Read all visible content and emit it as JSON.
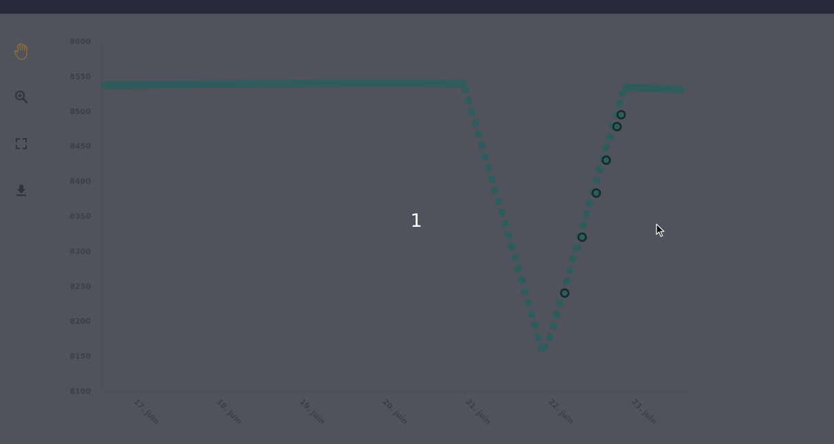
{
  "colors": {
    "background": "#50535b",
    "topbar": "#262a3c",
    "series": "#2f5b5c",
    "highlight_stroke": "#16292b",
    "axis_text": "#3b3f49",
    "tool_active": "#8a6a3c",
    "tool_icon": "#2f3340"
  },
  "toolbar": {
    "items": [
      {
        "name": "pan-hand-icon",
        "active": true
      },
      {
        "name": "zoom-in-icon",
        "active": false
      },
      {
        "name": "fullscreen-icon",
        "active": false
      },
      {
        "name": "download-icon",
        "active": false
      }
    ]
  },
  "overlay": {
    "number": "1"
  },
  "chart_data": {
    "type": "scatter",
    "title": "",
    "xlabel": "",
    "ylabel": "",
    "ylim": [
      8100,
      8600
    ],
    "yticks": [
      8100,
      8150,
      8200,
      8250,
      8300,
      8350,
      8400,
      8450,
      8500,
      8550,
      8600
    ],
    "xlim": [
      16.62,
      23.72
    ],
    "xticks": [
      {
        "value": 17,
        "label": "17. juin"
      },
      {
        "value": 18,
        "label": "18. juin"
      },
      {
        "value": 19,
        "label": "19. juin"
      },
      {
        "value": 20,
        "label": "20. juin"
      },
      {
        "value": 21,
        "label": "21. juin"
      },
      {
        "value": 22,
        "label": "22. juin"
      },
      {
        "value": 23,
        "label": "23. juin"
      }
    ],
    "grid": false,
    "series": [
      {
        "plateau_segments": [
          {
            "x": [
              16.65,
              17.5,
              18.5,
              19.5,
              20.5,
              20.98
            ],
            "y": [
              8537,
              8538,
              8539,
              8540,
              8540,
              8539
            ]
          },
          {
            "x": [
              22.99,
              23.6
            ],
            "y": [
              8534,
              8531
            ]
          }
        ],
        "points": [
          {
            "x": 21.0,
            "y": 8531
          },
          {
            "x": 21.04,
            "y": 8515
          },
          {
            "x": 21.08,
            "y": 8499
          },
          {
            "x": 21.12,
            "y": 8483
          },
          {
            "x": 21.16,
            "y": 8467
          },
          {
            "x": 21.2,
            "y": 8451
          },
          {
            "x": 21.24,
            "y": 8435
          },
          {
            "x": 21.28,
            "y": 8419
          },
          {
            "x": 21.32,
            "y": 8403
          },
          {
            "x": 21.36,
            "y": 8387
          },
          {
            "x": 21.4,
            "y": 8371
          },
          {
            "x": 21.44,
            "y": 8355
          },
          {
            "x": 21.48,
            "y": 8339
          },
          {
            "x": 21.52,
            "y": 8323
          },
          {
            "x": 21.56,
            "y": 8307
          },
          {
            "x": 21.6,
            "y": 8291
          },
          {
            "x": 21.64,
            "y": 8275
          },
          {
            "x": 21.68,
            "y": 8259
          },
          {
            "x": 21.72,
            "y": 8242
          },
          {
            "x": 21.76,
            "y": 8226
          },
          {
            "x": 21.8,
            "y": 8210
          },
          {
            "x": 21.84,
            "y": 8194
          },
          {
            "x": 21.88,
            "y": 8177
          },
          {
            "x": 21.92,
            "y": 8162
          },
          {
            "x": 21.96,
            "y": 8162
          },
          {
            "x": 22.02,
            "y": 8177
          },
          {
            "x": 22.06,
            "y": 8193
          },
          {
            "x": 22.1,
            "y": 8209
          },
          {
            "x": 22.14,
            "y": 8225
          },
          {
            "x": 22.18,
            "y": 8241
          },
          {
            "x": 22.22,
            "y": 8257
          },
          {
            "x": 22.26,
            "y": 8273
          },
          {
            "x": 22.3,
            "y": 8289
          },
          {
            "x": 22.34,
            "y": 8305
          },
          {
            "x": 22.38,
            "y": 8321
          },
          {
            "x": 22.42,
            "y": 8337
          },
          {
            "x": 22.46,
            "y": 8353
          },
          {
            "x": 22.5,
            "y": 8369
          },
          {
            "x": 22.54,
            "y": 8385
          },
          {
            "x": 22.58,
            "y": 8401
          },
          {
            "x": 22.62,
            "y": 8417
          },
          {
            "x": 22.66,
            "y": 8432
          },
          {
            "x": 22.7,
            "y": 8448
          },
          {
            "x": 22.74,
            "y": 8463
          },
          {
            "x": 22.78,
            "y": 8479
          },
          {
            "x": 22.82,
            "y": 8495
          },
          {
            "x": 22.86,
            "y": 8511
          },
          {
            "x": 22.9,
            "y": 8526
          },
          {
            "x": 22.94,
            "y": 8534
          }
        ],
        "highlighted": [
          {
            "x": 22.2,
            "y": 8240
          },
          {
            "x": 22.41,
            "y": 8320
          },
          {
            "x": 22.58,
            "y": 8383
          },
          {
            "x": 22.7,
            "y": 8430
          },
          {
            "x": 22.83,
            "y": 8478
          },
          {
            "x": 22.88,
            "y": 8495
          }
        ]
      }
    ]
  }
}
